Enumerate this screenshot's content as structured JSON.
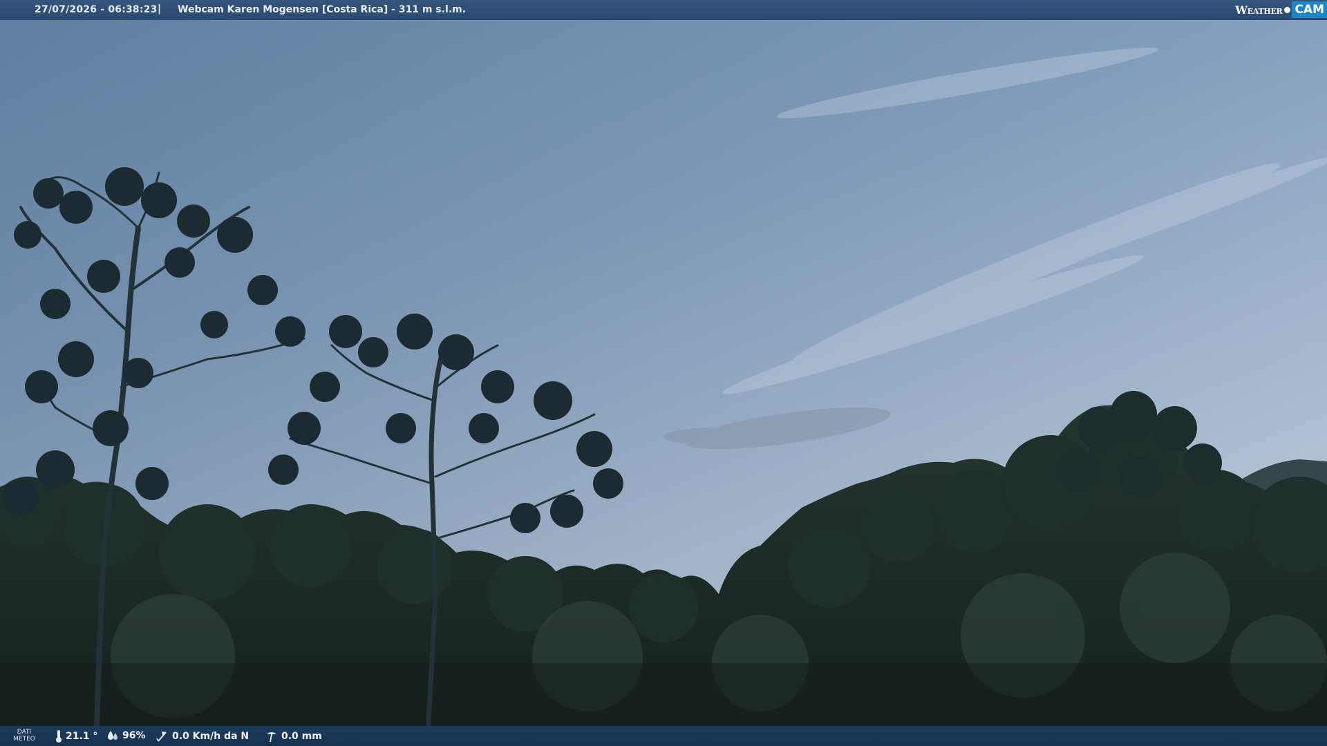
{
  "header": {
    "datetime": "27/07/2026 - 06:38:23",
    "separator": "|",
    "title": "Webcam Karen Mogensen [Costa Rica]  - 311 m s.l.m.",
    "brand_weather": "Weather",
    "brand_cam": "CAM"
  },
  "footer": {
    "dati_line1": "DATI",
    "dati_line2": "METEO",
    "temperature": "21.1 °",
    "humidity": "96%",
    "wind": "0.0 Km/h da N",
    "rain": "0.0 mm",
    "icons": [
      "thermometer-icon",
      "humidity-icon",
      "wind-icon",
      "rain-gauge-icon"
    ]
  },
  "colors": {
    "header_bg": "#2f5078",
    "footer_bg": "#1c3857",
    "brand_accent": "#1e86c8",
    "sky_top": "#6d8fb4",
    "sky_bottom": "#a9bdcf",
    "foliage": "#1a2a26"
  }
}
